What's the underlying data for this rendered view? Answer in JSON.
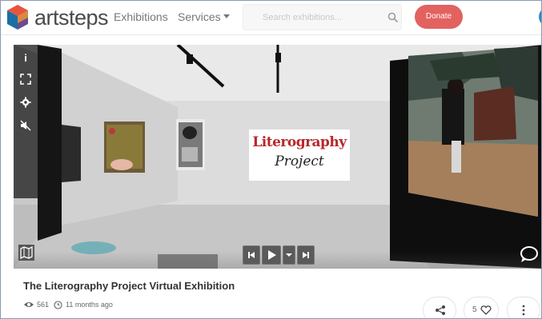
{
  "header": {
    "brand": "artsteps",
    "nav": {
      "exhibitions": "Exhibitions",
      "services": "Services"
    },
    "search": {
      "placeholder": "Search exhibitions..."
    },
    "donate_label": "Donate"
  },
  "viewer": {
    "toolbar": [
      {
        "icon": "info-icon"
      },
      {
        "icon": "fullscreen-icon"
      },
      {
        "icon": "gear-icon"
      },
      {
        "icon": "mute-icon"
      }
    ],
    "playback": [
      {
        "icon": "skip-back-icon"
      },
      {
        "icon": "play-icon"
      },
      {
        "icon": "chevron-down-icon"
      },
      {
        "icon": "skip-forward-icon"
      }
    ],
    "artwork_banner": {
      "line1": "Literography",
      "line2": "Project"
    }
  },
  "exhibition": {
    "title": "The Literography Project Virtual Exhibition",
    "views": "561",
    "posted": "11 months ago",
    "likes": "5"
  },
  "colors": {
    "donate": "#e2625f",
    "accent_blue": "#1e90c8"
  }
}
